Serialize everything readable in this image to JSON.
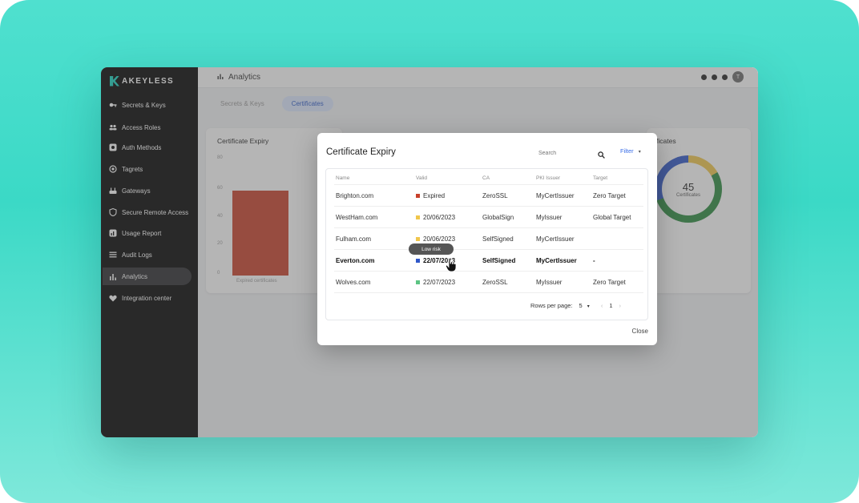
{
  "brand": {
    "name": "AKEYLESS"
  },
  "sidebar": {
    "items": [
      {
        "label": "Secrets & Keys",
        "icon": "key-icon"
      },
      {
        "label": "Access Roles",
        "icon": "users-icon"
      },
      {
        "label": "Auth Methods",
        "icon": "gear-icon"
      },
      {
        "label": "Tagrets",
        "icon": "target-icon"
      },
      {
        "label": "Gateways",
        "icon": "gateway-icon"
      },
      {
        "label": "Secure Remote Access",
        "icon": "shield-icon"
      },
      {
        "label": "Usage Report",
        "icon": "report-icon"
      },
      {
        "label": "Audit Logs",
        "icon": "list-icon"
      },
      {
        "label": "Analytics",
        "icon": "bar-chart-icon",
        "active": true
      },
      {
        "label": "Integration center",
        "icon": "heart-icon"
      }
    ]
  },
  "topbar": {
    "title": "Analytics",
    "user_initial": "T"
  },
  "tabs": [
    {
      "label": "Secrets & Keys"
    },
    {
      "label": "Certificates",
      "active": true
    }
  ],
  "cards": {
    "expiry": {
      "title": "Certificate Expiry",
      "y_ticks": [
        "80",
        "60",
        "40",
        "20",
        "0"
      ],
      "bar_label": "Expired certificates"
    },
    "donut": {
      "title": "ficates",
      "total": "45",
      "total_label": "Certificates"
    }
  },
  "modal": {
    "title": "Certificate Expiry",
    "search_placeholder": "Search",
    "filter_label": "Filter",
    "columns": [
      "Name",
      "Valid",
      "CA",
      "PKI Issuer",
      "Target"
    ],
    "rows": [
      {
        "name": "Brighton.com",
        "valid": "Expired",
        "status_color": "#c8402a",
        "ca": "ZeroSSL",
        "issuer": "MyCertIssuer",
        "target": "Zero Target"
      },
      {
        "name": "WestHam.com",
        "valid": "20/06/2023",
        "status_color": "#f0c64c",
        "ca": "GlobalSign",
        "issuer": "MyIssuer",
        "target": "Global Target"
      },
      {
        "name": "Fulham.com",
        "valid": "20/06/2023",
        "status_color": "#f0c64c",
        "ca": "SelfSigned",
        "issuer": "MyCertIssuer",
        "target": ""
      },
      {
        "name": "Everton.com",
        "valid": "22/07/2023",
        "status_color": "#2f57c9",
        "ca": "SelfSigned",
        "issuer": "MyCertIssuer",
        "target": "-"
      },
      {
        "name": "Wolves.com",
        "valid": "22/07/2023",
        "status_color": "#5cc483",
        "ca": "ZeroSSL",
        "issuer": "MyIssuer",
        "target": "Zero Target"
      }
    ],
    "rows_per_page_label": "Rows per page:",
    "rows_per_page": "5",
    "page": "1",
    "close_label": "Close",
    "tooltip": "Low risk"
  }
}
